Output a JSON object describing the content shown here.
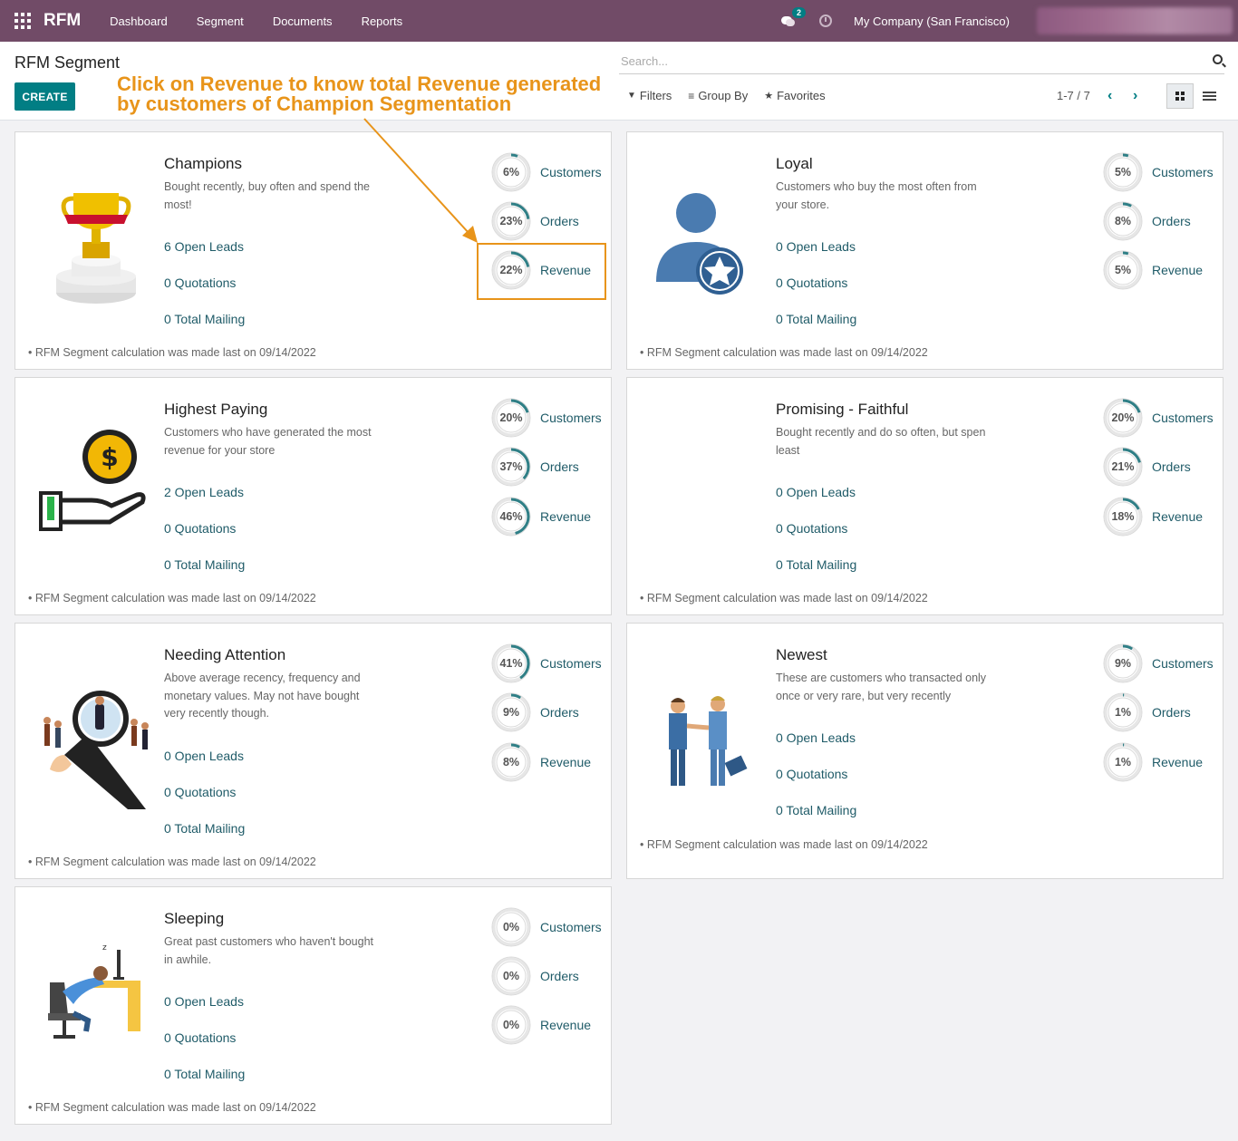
{
  "navbar": {
    "brand": "RFM",
    "menu": [
      "Dashboard",
      "Segment",
      "Documents",
      "Reports"
    ],
    "message_count": "2",
    "company": "My Company (San Francisco)"
  },
  "control": {
    "title": "RFM Segment",
    "create_label": "CREATE",
    "search_placeholder": "Search...",
    "filters_label": "Filters",
    "groupby_label": "Group By",
    "favorites_label": "Favorites",
    "pager": "1-7 / 7"
  },
  "annotation": {
    "line1": "Click on Revenue to know total Revenue generated",
    "line2": "by customers of Champion Segmentation"
  },
  "colors": {
    "navbar": "#714b67",
    "primary": "#017e84",
    "annotation": "#e8941a"
  },
  "labels": {
    "customers": "Customers",
    "orders": "Orders",
    "revenue": "Revenue"
  },
  "cards": [
    {
      "title": "Champions",
      "desc": "Bought recently, buy often and spend the most!",
      "leads": "6 Open Leads",
      "quotations": "0 Quotations",
      "mailing": "0 Total Mailing",
      "customers": 6,
      "orders": 23,
      "revenue": 22,
      "footer": "• RFM Segment calculation was made last on 09/14/2022",
      "icon": "trophy-icon"
    },
    {
      "title": "Loyal",
      "desc": "Customers who buy the most often from your store.",
      "leads": "0 Open Leads",
      "quotations": "0 Quotations",
      "mailing": "0 Total Mailing",
      "customers": 5,
      "orders": 8,
      "revenue": 5,
      "footer": "• RFM Segment calculation was made last on 09/14/2022",
      "icon": "user-star-icon"
    },
    {
      "title": "Highest Paying",
      "desc": "Customers who have generated the most revenue for your store",
      "leads": "2 Open Leads",
      "quotations": "0 Quotations",
      "mailing": "0 Total Mailing",
      "customers": 20,
      "orders": 37,
      "revenue": 46,
      "footer": "• RFM Segment calculation was made last on 09/14/2022",
      "icon": "hand-coin-icon"
    },
    {
      "title": "Promising - Faithful",
      "desc": "Bought recently and do so often, but spen least",
      "leads": "0 Open Leads",
      "quotations": "0 Quotations",
      "mailing": "0 Total Mailing",
      "customers": 20,
      "orders": 21,
      "revenue": 18,
      "footer": "• RFM Segment calculation was made last on 09/14/2022",
      "icon": ""
    },
    {
      "title": "Needing Attention",
      "desc": "Above average recency, frequency and monetary values. May not have bought very recently though.",
      "leads": "0 Open Leads",
      "quotations": "0 Quotations",
      "mailing": "0 Total Mailing",
      "customers": 41,
      "orders": 9,
      "revenue": 8,
      "footer": "• RFM Segment calculation was made last on 09/14/2022",
      "icon": "magnifier-people-icon"
    },
    {
      "title": "Newest",
      "desc": "These are customers who transacted only once or very rare, but very recently",
      "leads": "0 Open Leads",
      "quotations": "0 Quotations",
      "mailing": "0 Total Mailing",
      "customers": 9,
      "orders": 1,
      "revenue": 1,
      "footer": "• RFM Segment calculation was made last on 09/14/2022",
      "icon": "handshake-icon"
    },
    {
      "title": "Sleeping",
      "desc": "Great past customers who haven't bought in awhile.",
      "leads": "0 Open Leads",
      "quotations": "0 Quotations",
      "mailing": "0 Total Mailing",
      "customers": 0,
      "orders": 0,
      "revenue": 0,
      "footer": "• RFM Segment calculation was made last on 09/14/2022",
      "icon": "sleeping-desk-icon"
    }
  ]
}
